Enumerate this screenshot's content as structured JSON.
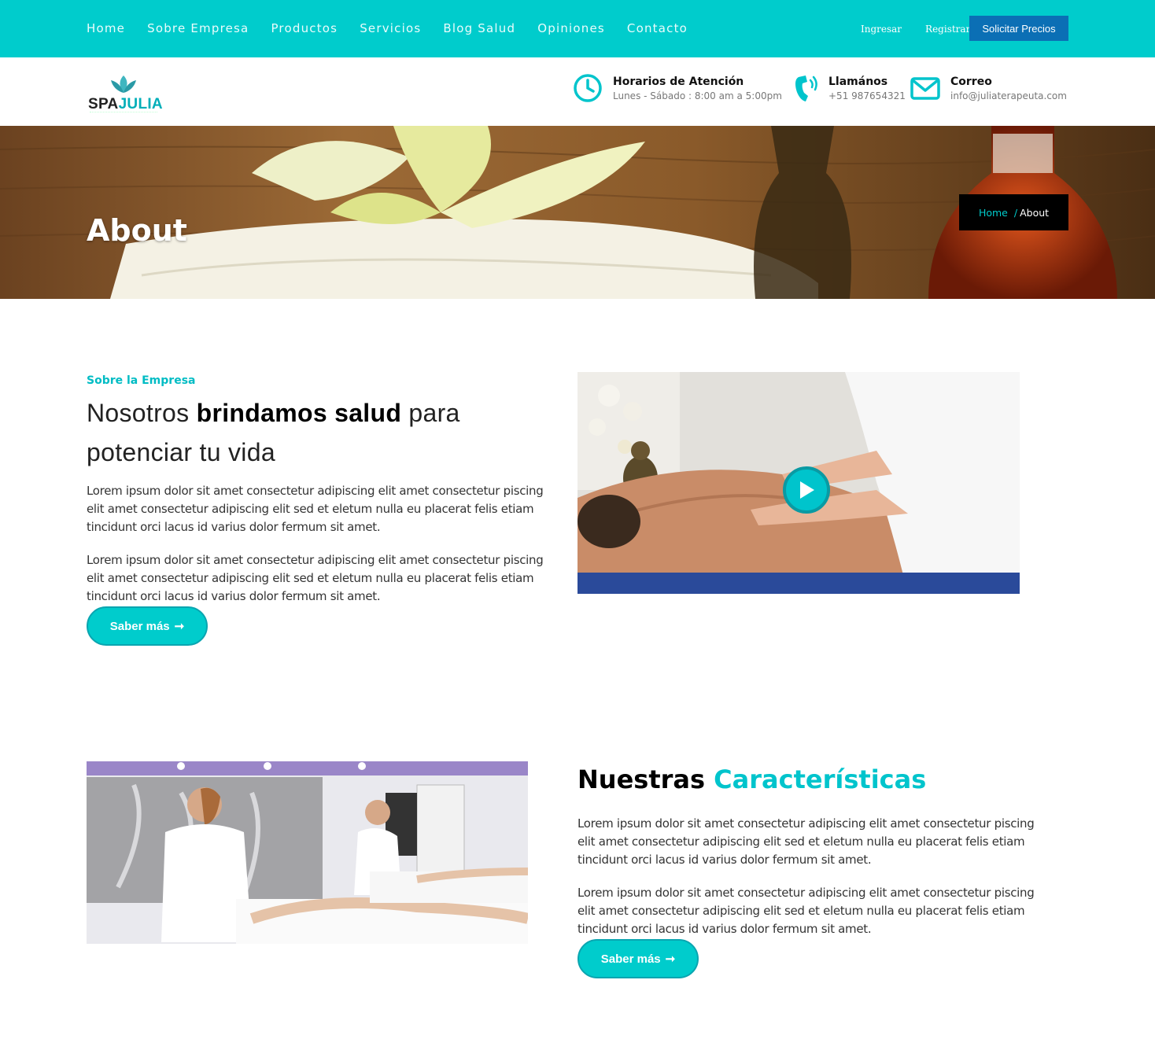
{
  "colors": {
    "brand": "#00cccc",
    "accent": "#00bcc4",
    "cta": "#0b6fb5",
    "dark": "#000000"
  },
  "nav": {
    "items": [
      "Home",
      "Sobre Empresa",
      "Productos",
      "Servicios",
      "Blog Salud",
      "Opiniones",
      "Contacto"
    ],
    "login": "Ingresar",
    "register": "Registrar",
    "quote": "Solicitar Precios"
  },
  "logo": {
    "spa": "SPA",
    "julia": "JULIA",
    "icon": "lotus-icon"
  },
  "info": {
    "hours_title": "Horarios de Atención",
    "hours_sub": "Lunes - Sábado : 8:00 am a 5:00pm",
    "call_title": "Llamános",
    "call_sub": "+51 987654321",
    "mail_title": "Correo",
    "mail_sub": "info@juliaterapeuta.com",
    "icons": [
      "clock-icon",
      "phone-icon",
      "envelope-icon"
    ]
  },
  "hero": {
    "title": "About",
    "breadcrumb": {
      "home": "Home",
      "sep": "/",
      "current": "About"
    }
  },
  "about": {
    "eyebrow": "Sobre la Empresa",
    "heading_pre": "Nosotros ",
    "heading_bold": "brindamos salud",
    "heading_post": " para potenciar tu vida",
    "para1": "Lorem ipsum dolor sit amet consectetur adipiscing elit amet consectetur piscing elit amet consectetur adipiscing elit sed et eletum nulla eu placerat felis etiam tincidunt orci lacus id varius dolor fermum sit amet.",
    "para2": "Lorem ipsum dolor sit amet consectetur adipiscing elit amet consectetur piscing elit amet consectetur adipiscing elit sed et eletum nulla eu placerat felis etiam tincidunt orci lacus id varius dolor fermum sit amet.",
    "button": "Saber más",
    "button_icon": "arrow-right-icon",
    "video_icon": "play-icon"
  },
  "features": {
    "heading_pre": "Nuestras ",
    "heading_accent": "Características",
    "para1": "Lorem ipsum dolor sit amet consectetur adipiscing elit amet consectetur piscing elit amet consectetur adipiscing elit sed et eletum nulla eu placerat felis etiam tincidunt orci lacus id varius dolor fermum sit amet.",
    "para2": "Lorem ipsum dolor sit amet consectetur adipiscing elit amet consectetur piscing elit amet consectetur adipiscing elit sed et eletum nulla eu placerat felis etiam tincidunt orci lacus id varius dolor fermum sit amet.",
    "button": "Saber más"
  }
}
